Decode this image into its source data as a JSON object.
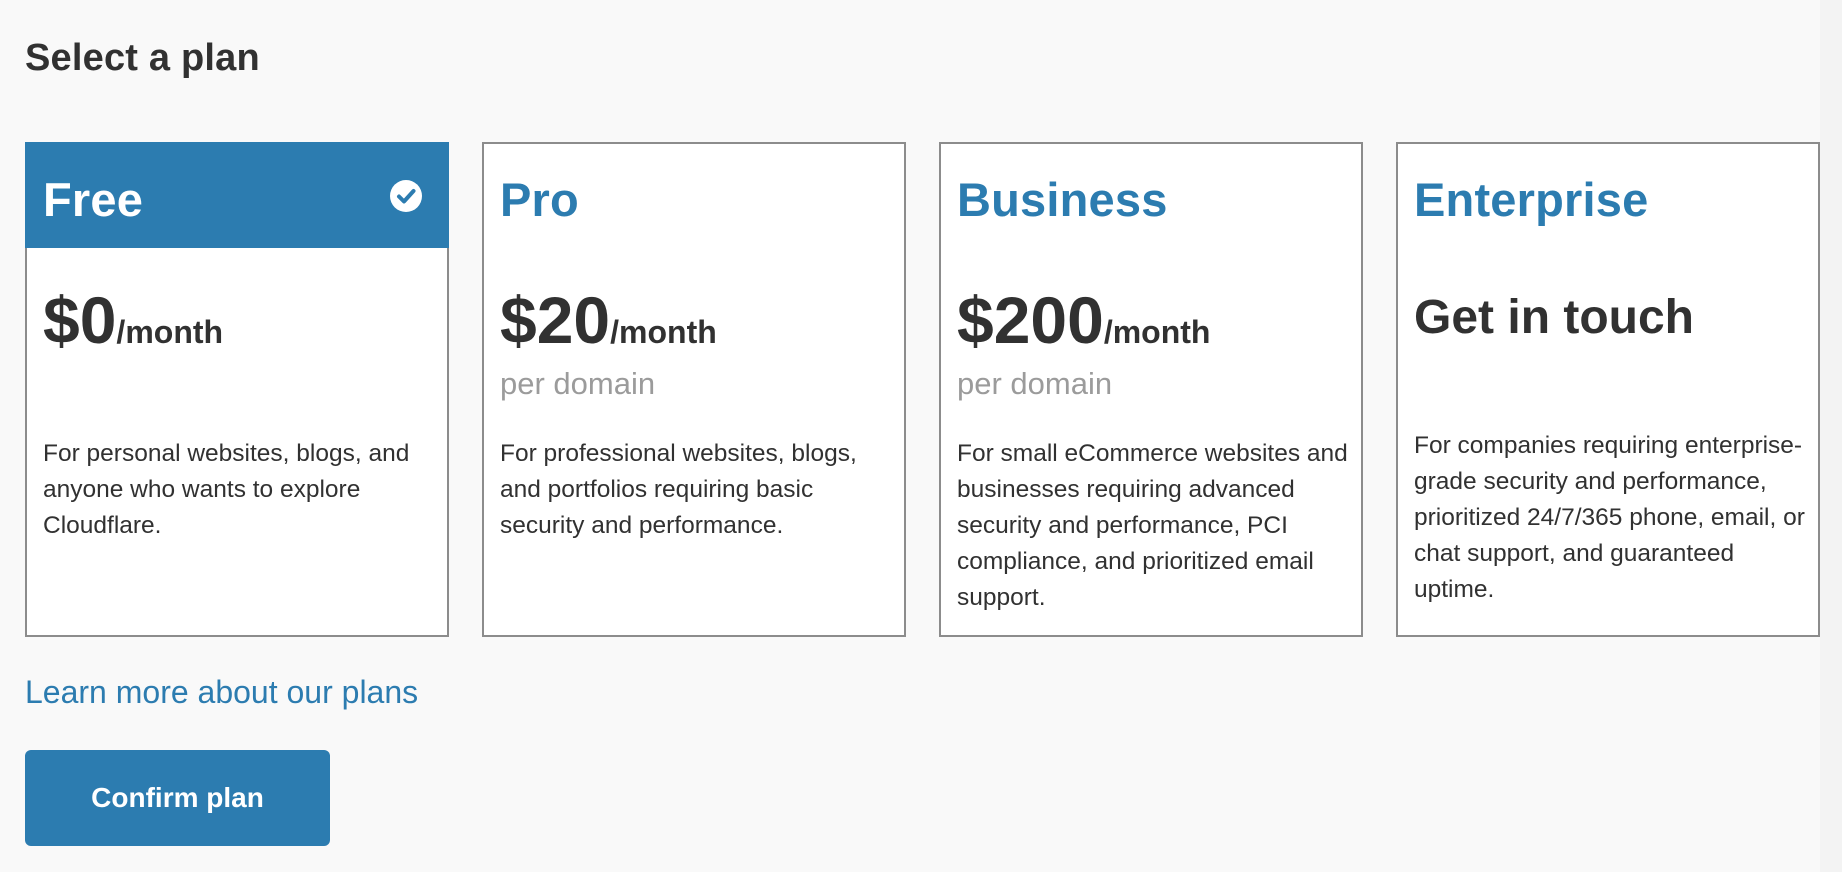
{
  "page": {
    "title": "Select a plan"
  },
  "plans": [
    {
      "name": "Free",
      "selected": true,
      "price": "$0",
      "price_unit": "/month",
      "price_sub": "",
      "description": "For personal websites, blogs, and anyone who wants to explore Cloudflare."
    },
    {
      "name": "Pro",
      "selected": false,
      "price": "$20",
      "price_unit": "/month",
      "price_sub": "per domain",
      "description": "For professional websites, blogs, and portfolios requiring basic security and performance."
    },
    {
      "name": "Business",
      "selected": false,
      "price": "$200",
      "price_unit": "/month",
      "price_sub": "per domain",
      "description": "For small eCommerce websites and businesses requiring advanced security and performance, PCI compliance, and prioritized email support."
    },
    {
      "name": "Enterprise",
      "selected": false,
      "contact": "Get in touch",
      "description": "For companies requiring enterprise-grade security and performance, prioritized 24/7/365 phone, email, or chat support, and guaranteed uptime."
    }
  ],
  "links": {
    "learn_more": "Learn more about our plans"
  },
  "actions": {
    "confirm_label": "Confirm plan"
  },
  "icons": {
    "selected_plan": "check-circle-icon"
  },
  "colors": {
    "accent": "#2c7cb0",
    "text": "#313131",
    "muted_text": "#9b9b9b",
    "card_border": "#8c8c8c"
  }
}
